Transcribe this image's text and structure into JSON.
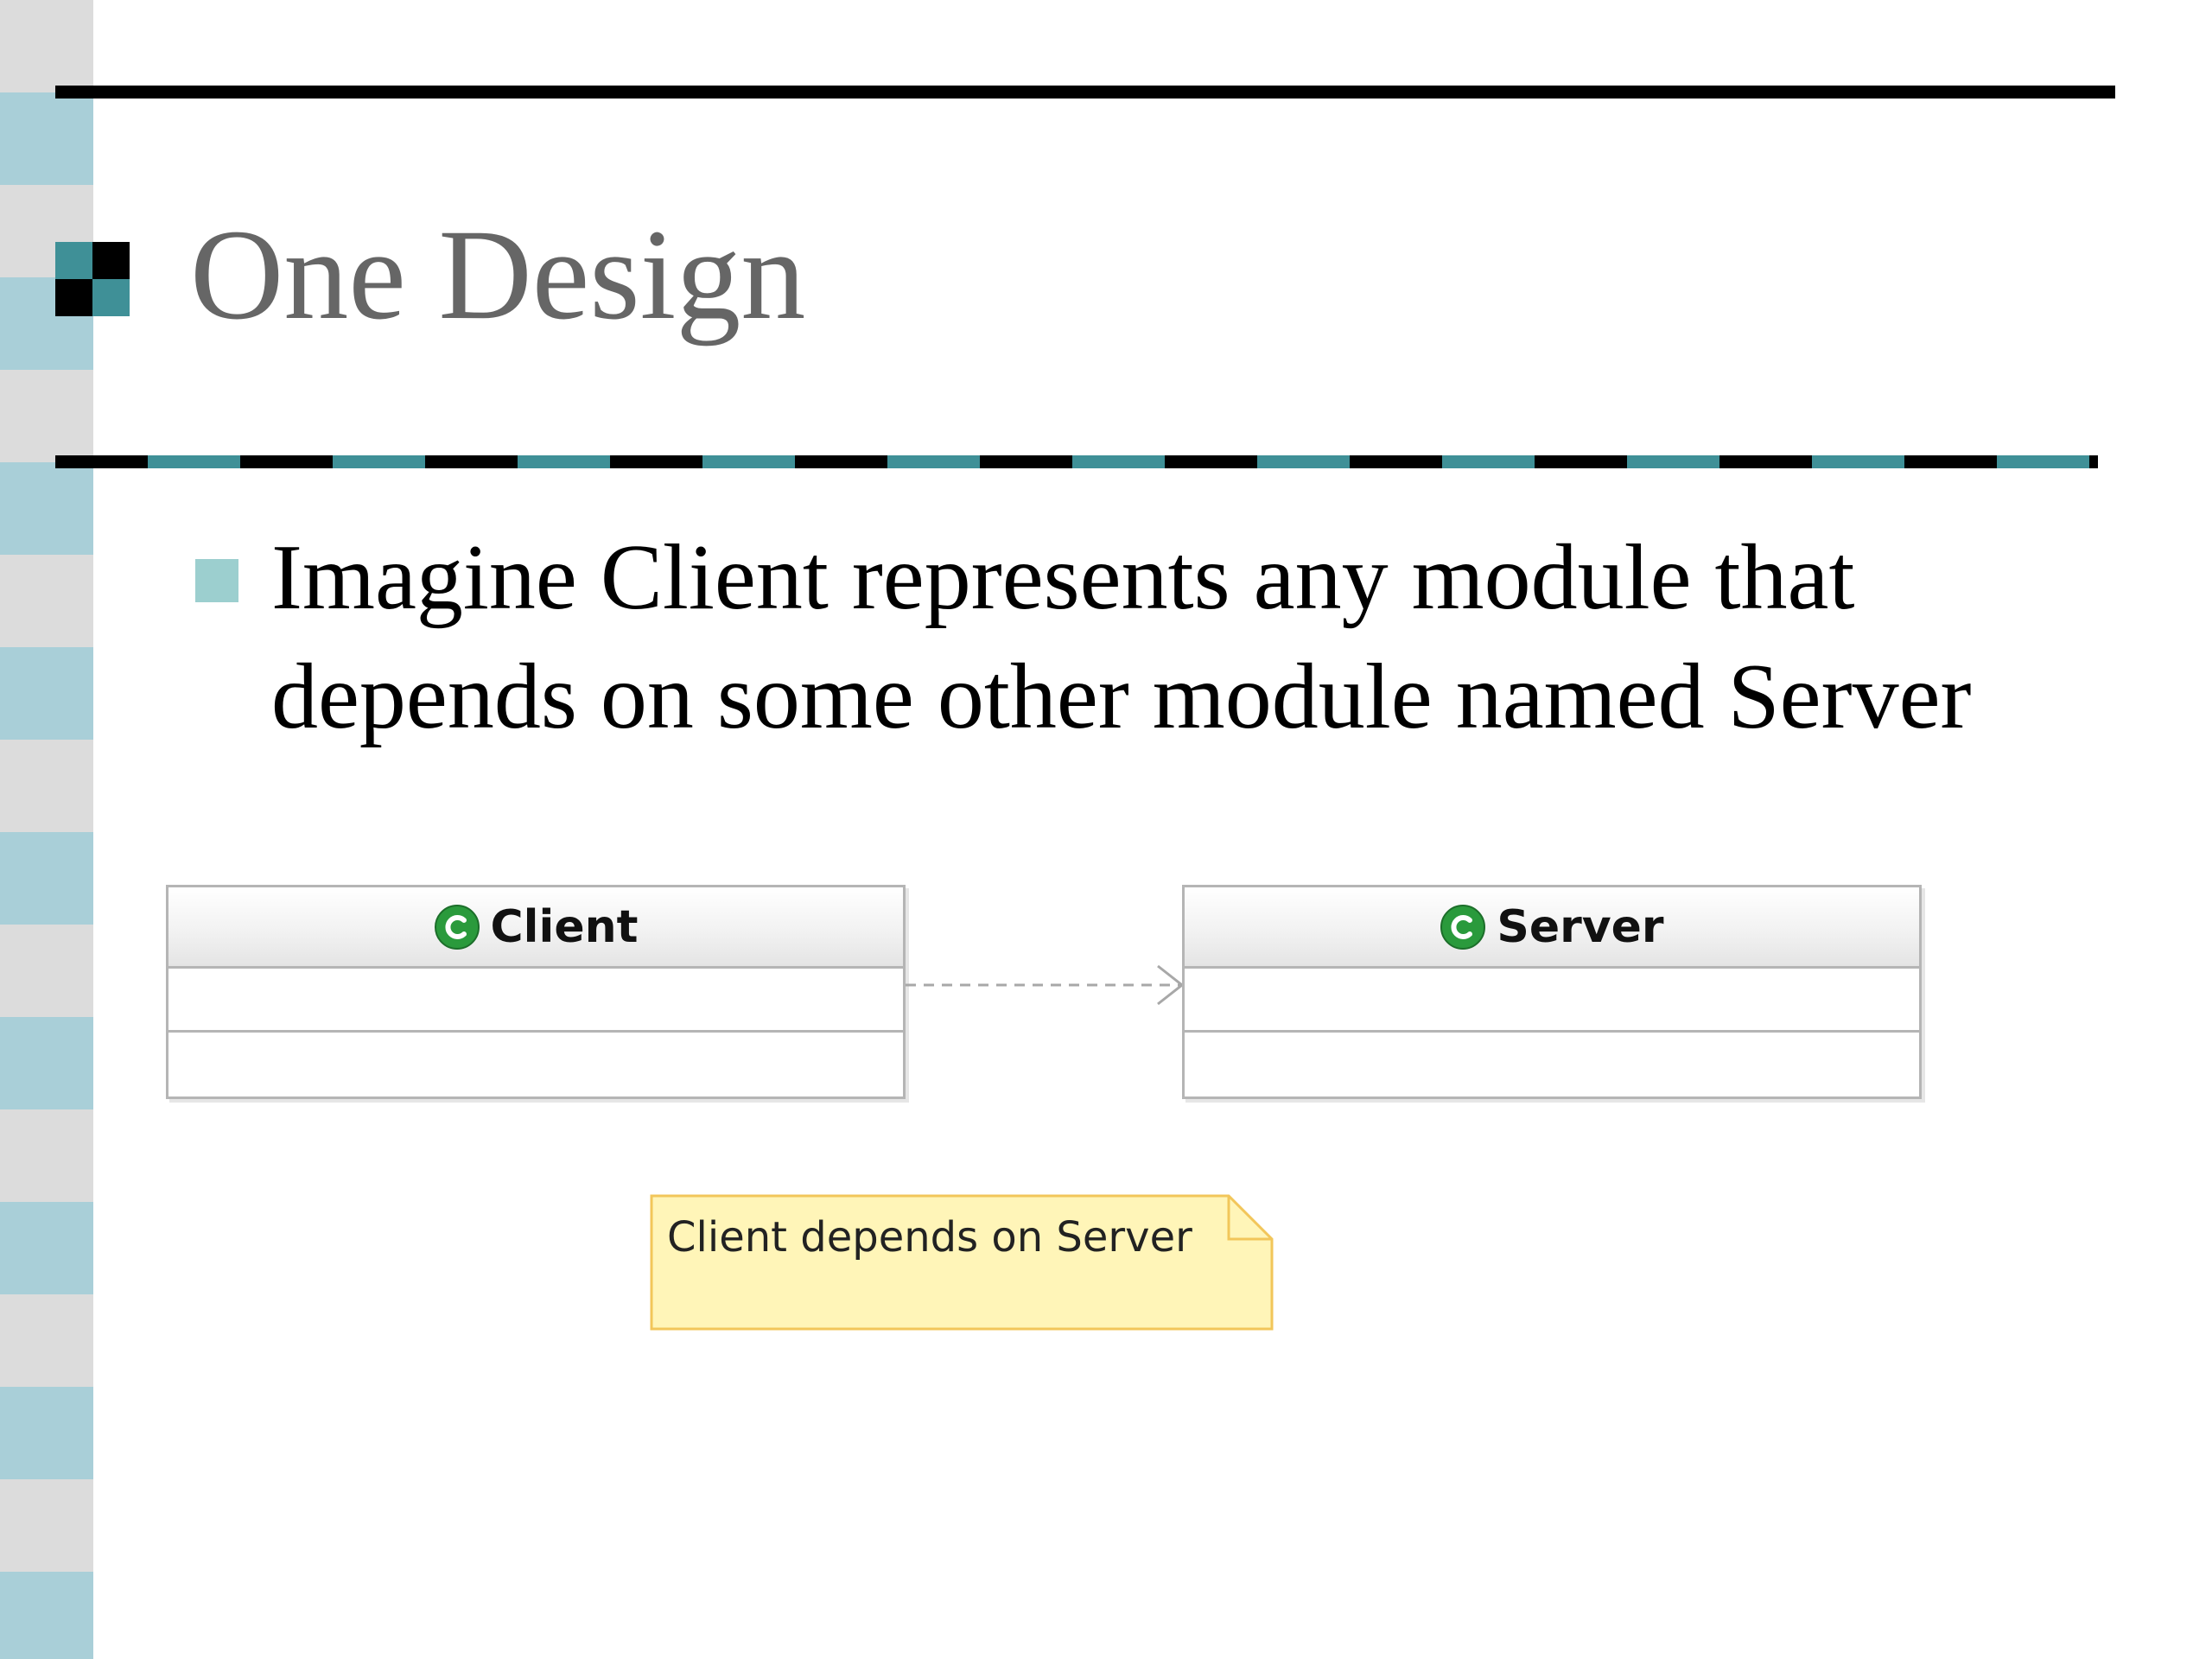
{
  "slide": {
    "title": "One Design",
    "bullet_text": "Imagine Client represents any module that depends on some other module named Server"
  },
  "diagram": {
    "classes": [
      {
        "name": "Client",
        "icon": "class-icon"
      },
      {
        "name": "Server",
        "icon": "class-icon"
      }
    ],
    "relationship": {
      "type": "dependency",
      "from": "Client",
      "to": "Server"
    },
    "note": "Client depends on Server"
  },
  "colors": {
    "title_text": "#666666",
    "stripe_gray": "#dcdcdc",
    "stripe_blue": "#a9cfd8",
    "teal_accent": "#3f9097",
    "bullet": "#9ccfcf",
    "class_icon_green": "#2a9a3c",
    "note_fill": "#fff5b8",
    "note_border": "#f2c65a"
  },
  "icons": {
    "title_marker": "checker-square-icon",
    "bullet": "square-bullet-icon",
    "class": "class-icon"
  }
}
